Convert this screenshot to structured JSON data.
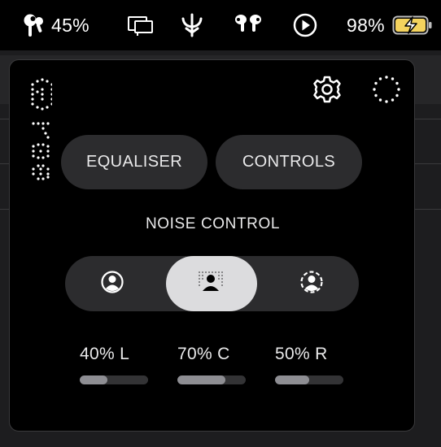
{
  "menubar": {
    "earbuds_battery": "45%",
    "mac_battery": "98%",
    "icons": [
      "earbud-icon",
      "display-mirroring-icon",
      "bluetooth-icon",
      "airpods-icon",
      "play-icon",
      "battery-charging-icon"
    ]
  },
  "panel": {
    "logo_text": "ear (1)",
    "header_icons": [
      "gear-icon",
      "dotted-loading-icon"
    ],
    "buttons": {
      "equaliser": "EQUALISER",
      "controls": "CONTROLS"
    },
    "noise_control": {
      "title": "NOISE CONTROL",
      "options": [
        "anc-person-icon",
        "transparency-person-icon",
        "off-person-icon"
      ],
      "selected_index": 1
    },
    "levels": [
      {
        "label": "40% L",
        "value": 0.4
      },
      {
        "label": "70% C",
        "value": 0.7
      },
      {
        "label": "50% R",
        "value": 0.5
      }
    ]
  },
  "colors": {
    "panel_bg": "#000000",
    "pill_bg": "#2c2c2e",
    "active_segment": "#dcdcde",
    "bar_fill": "#8e8e93",
    "battery_fill": "#f4d35e"
  }
}
